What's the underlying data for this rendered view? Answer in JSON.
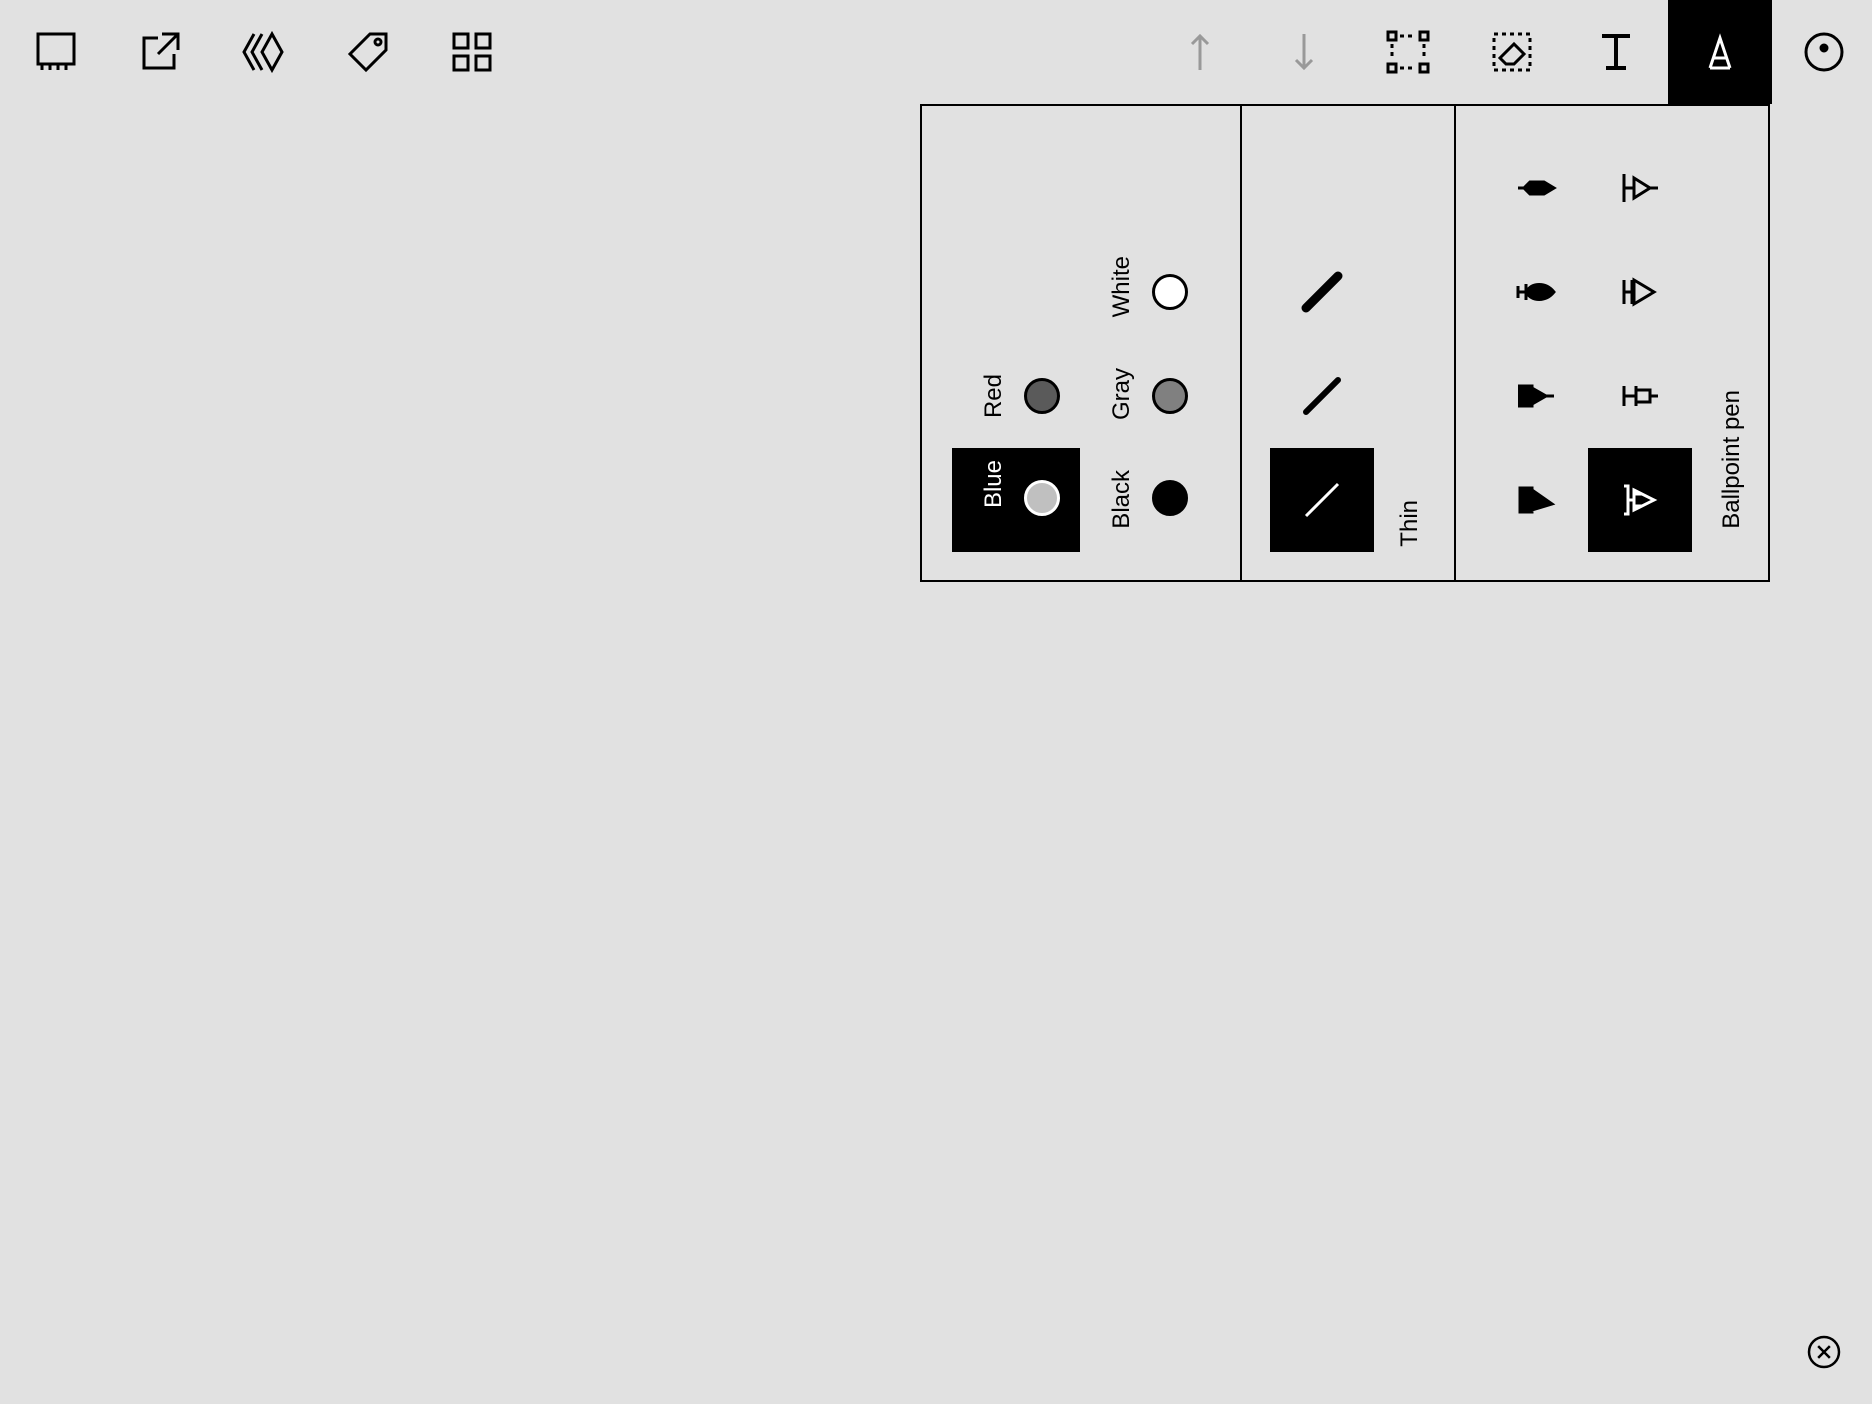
{
  "toolbar": {
    "left_icons": [
      "notebook-icon",
      "export-icon",
      "layers-icon",
      "tag-icon",
      "grid-icon"
    ],
    "right_icons": [
      "undo-icon",
      "redo-icon",
      "selection-icon",
      "eraser-icon",
      "text-icon",
      "pen-tool-icon",
      "circle-menu-icon"
    ]
  },
  "panel": {
    "colors": [
      {
        "label": "Blue",
        "fill": "#c0c0c0",
        "selected": true
      },
      {
        "label": "Red",
        "fill": "#5a5a5a",
        "selected": false
      },
      {
        "label": "Black",
        "fill": "#000000",
        "selected": false
      },
      {
        "label": "Gray",
        "fill": "#808080",
        "selected": false
      },
      {
        "label": "White",
        "fill": "#ffffff",
        "selected": false
      }
    ],
    "thickness_label": "Thin",
    "tool_label": "Ballpoint pen"
  },
  "bottom": {
    "close_icon": "close-circle-icon"
  }
}
